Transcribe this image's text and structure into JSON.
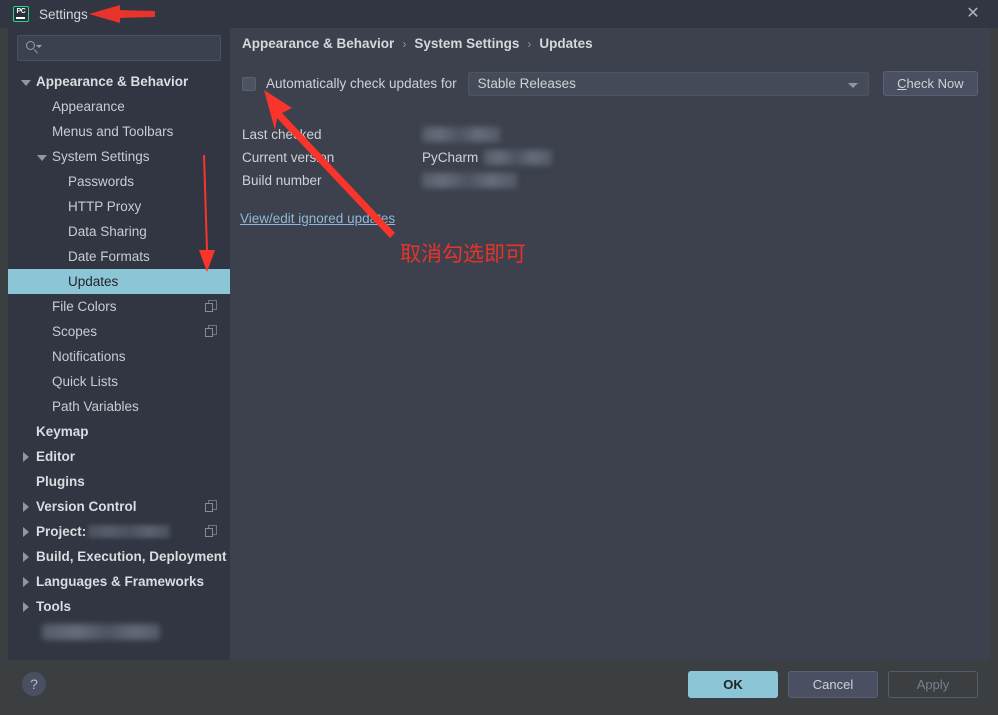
{
  "window": {
    "title": "Settings",
    "app_icon": "pycharm-logo-icon",
    "close_icon": "close-icon"
  },
  "sidebar": {
    "search": {
      "placeholder": "",
      "value": "",
      "icon": "search-icon"
    },
    "items": [
      {
        "label": "Appearance & Behavior",
        "indent": 0,
        "twisty": "down",
        "bold": true,
        "selected": false,
        "badge": null
      },
      {
        "label": "Appearance",
        "indent": 1,
        "twisty": "none",
        "bold": false,
        "selected": false,
        "badge": null
      },
      {
        "label": "Menus and Toolbars",
        "indent": 1,
        "twisty": "none",
        "bold": false,
        "selected": false,
        "badge": null
      },
      {
        "label": "System Settings",
        "indent": 1,
        "twisty": "down",
        "bold": false,
        "selected": false,
        "badge": null
      },
      {
        "label": "Passwords",
        "indent": 2,
        "twisty": "none",
        "bold": false,
        "selected": false,
        "badge": null
      },
      {
        "label": "HTTP Proxy",
        "indent": 2,
        "twisty": "none",
        "bold": false,
        "selected": false,
        "badge": null
      },
      {
        "label": "Data Sharing",
        "indent": 2,
        "twisty": "none",
        "bold": false,
        "selected": false,
        "badge": null
      },
      {
        "label": "Date Formats",
        "indent": 2,
        "twisty": "none",
        "bold": false,
        "selected": false,
        "badge": null
      },
      {
        "label": "Updates",
        "indent": 2,
        "twisty": "none",
        "bold": false,
        "selected": true,
        "badge": null
      },
      {
        "label": "File Colors",
        "indent": 1,
        "twisty": "none",
        "bold": false,
        "selected": false,
        "badge": "copy-icon"
      },
      {
        "label": "Scopes",
        "indent": 1,
        "twisty": "none",
        "bold": false,
        "selected": false,
        "badge": "copy-icon"
      },
      {
        "label": "Notifications",
        "indent": 1,
        "twisty": "none",
        "bold": false,
        "selected": false,
        "badge": null
      },
      {
        "label": "Quick Lists",
        "indent": 1,
        "twisty": "none",
        "bold": false,
        "selected": false,
        "badge": null
      },
      {
        "label": "Path Variables",
        "indent": 1,
        "twisty": "none",
        "bold": false,
        "selected": false,
        "badge": null
      },
      {
        "label": "Keymap",
        "indent": 0,
        "twisty": "none",
        "bold": true,
        "selected": false,
        "badge": null
      },
      {
        "label": "Editor",
        "indent": 0,
        "twisty": "right",
        "bold": true,
        "selected": false,
        "badge": null
      },
      {
        "label": "Plugins",
        "indent": 0,
        "twisty": "none",
        "bold": true,
        "selected": false,
        "badge": null
      },
      {
        "label": "Version Control",
        "indent": 0,
        "twisty": "right",
        "bold": true,
        "selected": false,
        "badge": "copy-icon"
      },
      {
        "label": "Project:",
        "indent": 0,
        "twisty": "right",
        "bold": true,
        "selected": false,
        "badge": "copy-icon",
        "redacted_after_label": true
      },
      {
        "label": "Build, Execution, Deployment",
        "indent": 0,
        "twisty": "right",
        "bold": true,
        "selected": false,
        "badge": null
      },
      {
        "label": "Languages & Frameworks",
        "indent": 0,
        "twisty": "right",
        "bold": true,
        "selected": false,
        "badge": null
      },
      {
        "label": "Tools",
        "indent": 0,
        "twisty": "right",
        "bold": true,
        "selected": false,
        "badge": null
      }
    ],
    "redacted_last_row": true
  },
  "content": {
    "breadcrumb": [
      "Appearance & Behavior",
      "System Settings",
      "Updates"
    ],
    "breadcrumb_separator": "›",
    "auto_check": {
      "checked": false,
      "label": "Automatically check updates for",
      "channel_value": "Stable Releases",
      "check_now_label": "Check Now",
      "check_now_mnemonic": "C"
    },
    "info_rows": [
      {
        "label": "Last checked",
        "value": "",
        "redacted": true,
        "prefix": ""
      },
      {
        "label": "Current version",
        "value": "",
        "redacted": true,
        "prefix": "PyCharm"
      },
      {
        "label": "Build number",
        "value": "",
        "redacted": true,
        "prefix": ""
      }
    ],
    "ignored_updates_link": "View/edit ignored updates"
  },
  "footer": {
    "help_label": "?",
    "ok_label": "OK",
    "cancel_label": "Cancel",
    "apply_label": "Apply",
    "apply_disabled": true
  },
  "annotations": {
    "color": "#e8332a",
    "note_text": "取消勾选即可",
    "arrows": [
      {
        "name": "arrow-to-title",
        "direction": "left"
      },
      {
        "name": "arrow-to-updates",
        "direction": "down"
      },
      {
        "name": "arrow-to-checkbox",
        "direction": "up-left"
      }
    ]
  },
  "colors": {
    "dialog_bg": "#3c3f41",
    "panel_bg": "#313642",
    "content_bg": "#3c414d",
    "selection": "#8cc5d6",
    "accent_green": "#21d789",
    "link": "#8fb8d8",
    "annotation_red": "#e8332a"
  }
}
